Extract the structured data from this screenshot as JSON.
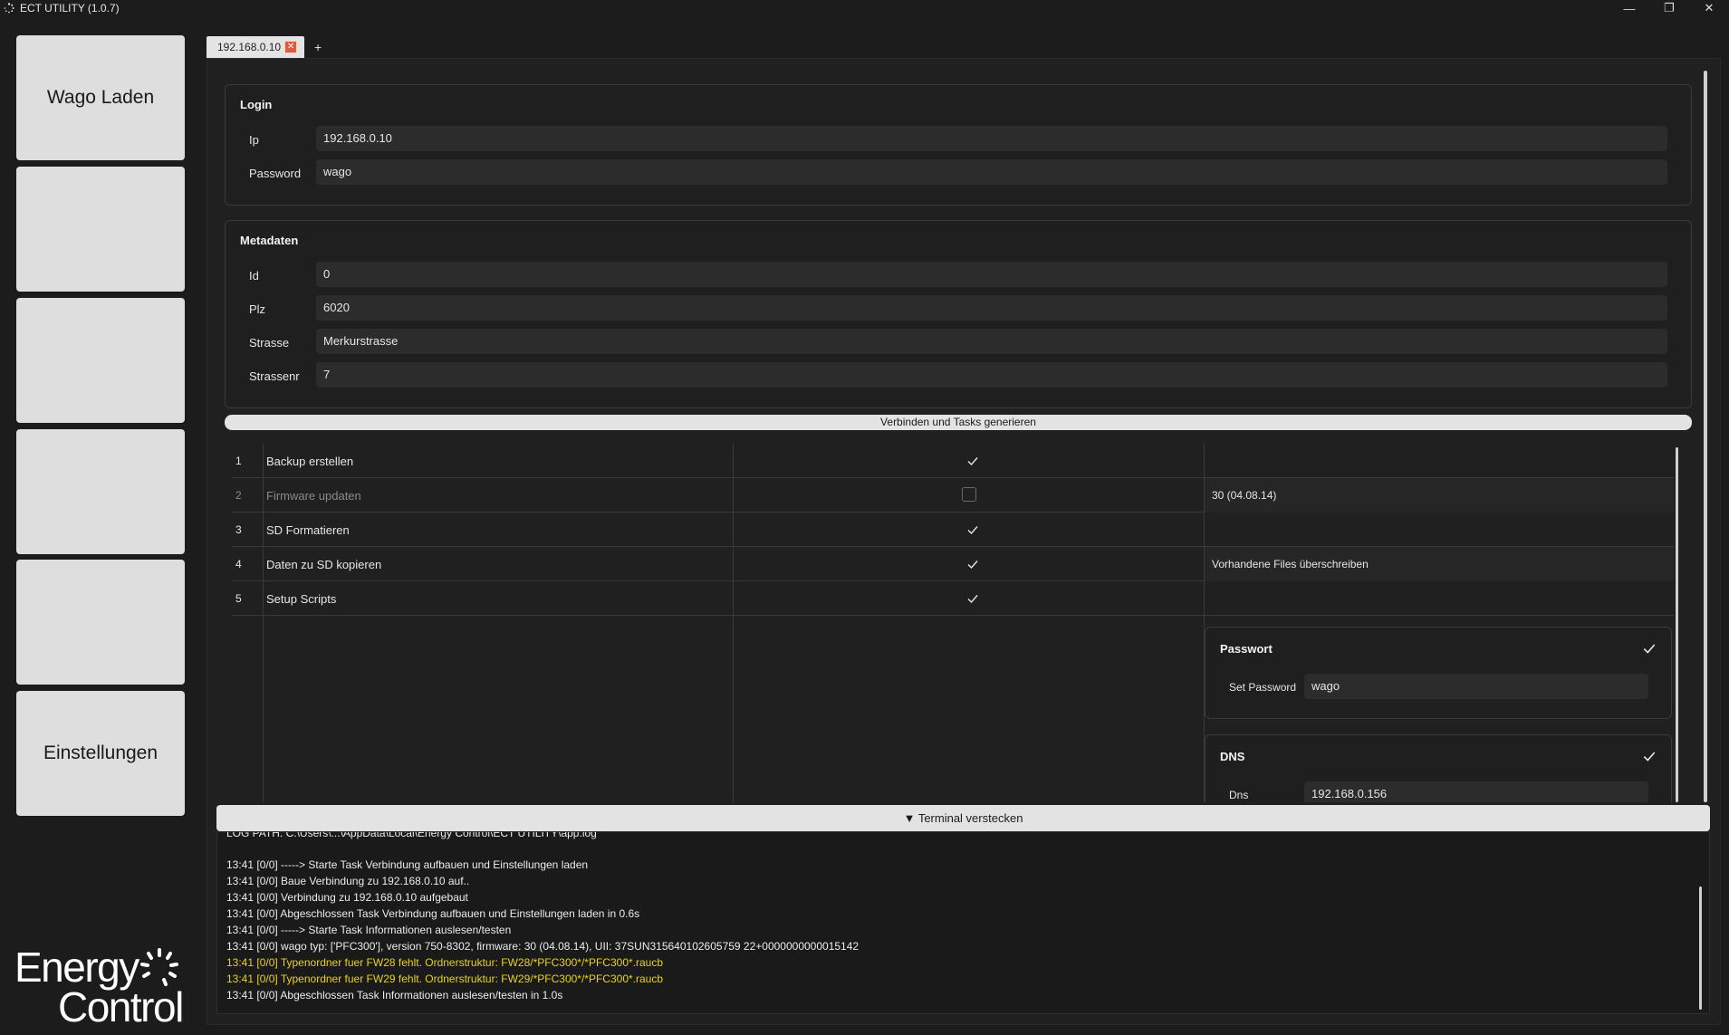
{
  "window": {
    "title": "ECT UTILITY (1.0.7)",
    "minimize": "—",
    "maximize": "❐",
    "close": "✕"
  },
  "sidebar": {
    "items": [
      {
        "label": "Wago Laden"
      },
      {
        "label": ""
      },
      {
        "label": ""
      },
      {
        "label": ""
      },
      {
        "label": ""
      },
      {
        "label": "Einstellungen"
      }
    ],
    "logo": {
      "line1": "Energy",
      "line2": "Control"
    }
  },
  "tabs": {
    "items": [
      {
        "label": "192.168.0.10",
        "close": "✕"
      }
    ],
    "add_label": "+"
  },
  "login": {
    "title": "Login",
    "ip_label": "Ip",
    "ip_value": "192.168.0.10",
    "password_label": "Password",
    "password_value": "wago"
  },
  "metadata": {
    "title": "Metadaten",
    "fields": [
      {
        "label": "Id",
        "value": "0"
      },
      {
        "label": "Plz",
        "value": "6020"
      },
      {
        "label": "Strasse",
        "value": "Merkurstrasse"
      },
      {
        "label": "Strassenr",
        "value": "7"
      }
    ]
  },
  "connect_button": "Verbinden und Tasks generieren",
  "tasks": [
    {
      "num": "1",
      "name": "Backup erstellen",
      "checked": true,
      "enabled": true,
      "extra": ""
    },
    {
      "num": "2",
      "name": "Firmware updaten",
      "checked": false,
      "enabled": false,
      "extra": "30 (04.08.14)"
    },
    {
      "num": "3",
      "name": "SD Formatieren",
      "checked": true,
      "enabled": true,
      "extra": ""
    },
    {
      "num": "4",
      "name": "Daten zu SD kopieren",
      "checked": true,
      "enabled": true,
      "extra": "Vorhandene Files überschreiben"
    },
    {
      "num": "5",
      "name": "Setup Scripts",
      "checked": true,
      "enabled": true,
      "extra": ""
    }
  ],
  "passwort_group": {
    "title": "Passwort",
    "label": "Set Password",
    "value": "wago"
  },
  "dns_group": {
    "title": "DNS",
    "label": "Dns",
    "value": "192.168.0.156"
  },
  "terminal": {
    "toggle_label": "▼ Terminal verstecken",
    "lines": [
      {
        "text": "LOG PATH: C:\\Users\\...\\AppData\\Local\\Energy Control\\ECT UTILITY\\app.log",
        "level": "info"
      },
      {
        "text": "",
        "level": "info"
      },
      {
        "text": "13:41 [0/0] -----> Starte Task Verbindung aufbauen und Einstellungen laden",
        "level": "info"
      },
      {
        "text": "13:41 [0/0] Baue Verbindung zu 192.168.0.10 auf..",
        "level": "info"
      },
      {
        "text": "13:41 [0/0] Verbindung zu 192.168.0.10 aufgebaut",
        "level": "info"
      },
      {
        "text": "13:41 [0/0] Abgeschlossen Task Verbindung aufbauen und Einstellungen laden in 0.6s",
        "level": "info"
      },
      {
        "text": "13:41 [0/0] -----> Starte Task Informationen auslesen/testen",
        "level": "info"
      },
      {
        "text": "13:41 [0/0] wago typ: ['PFC300'], version 750-8302, firmware: 30 (04.08.14), UII: 37SUN315640102605759 22+0000000000015142",
        "level": "info"
      },
      {
        "text": "13:41 [0/0] Typenordner fuer FW28 fehlt. Ordnerstruktur: FW28/*PFC300*/*PFC300*.raucb",
        "level": "warn"
      },
      {
        "text": "13:41 [0/0] Typenordner fuer FW29 fehlt. Ordnerstruktur: FW29/*PFC300*/*PFC300*.raucb",
        "level": "warn"
      },
      {
        "text": "13:41 [0/0] Abgeschlossen Task Informationen auslesen/testen in 1.0s",
        "level": "info"
      }
    ]
  },
  "colors": {
    "background": "#1c1c1c",
    "button": "#e3e3e3",
    "warn_text": "#e8d21a",
    "tab_close": "#e05a3c"
  }
}
